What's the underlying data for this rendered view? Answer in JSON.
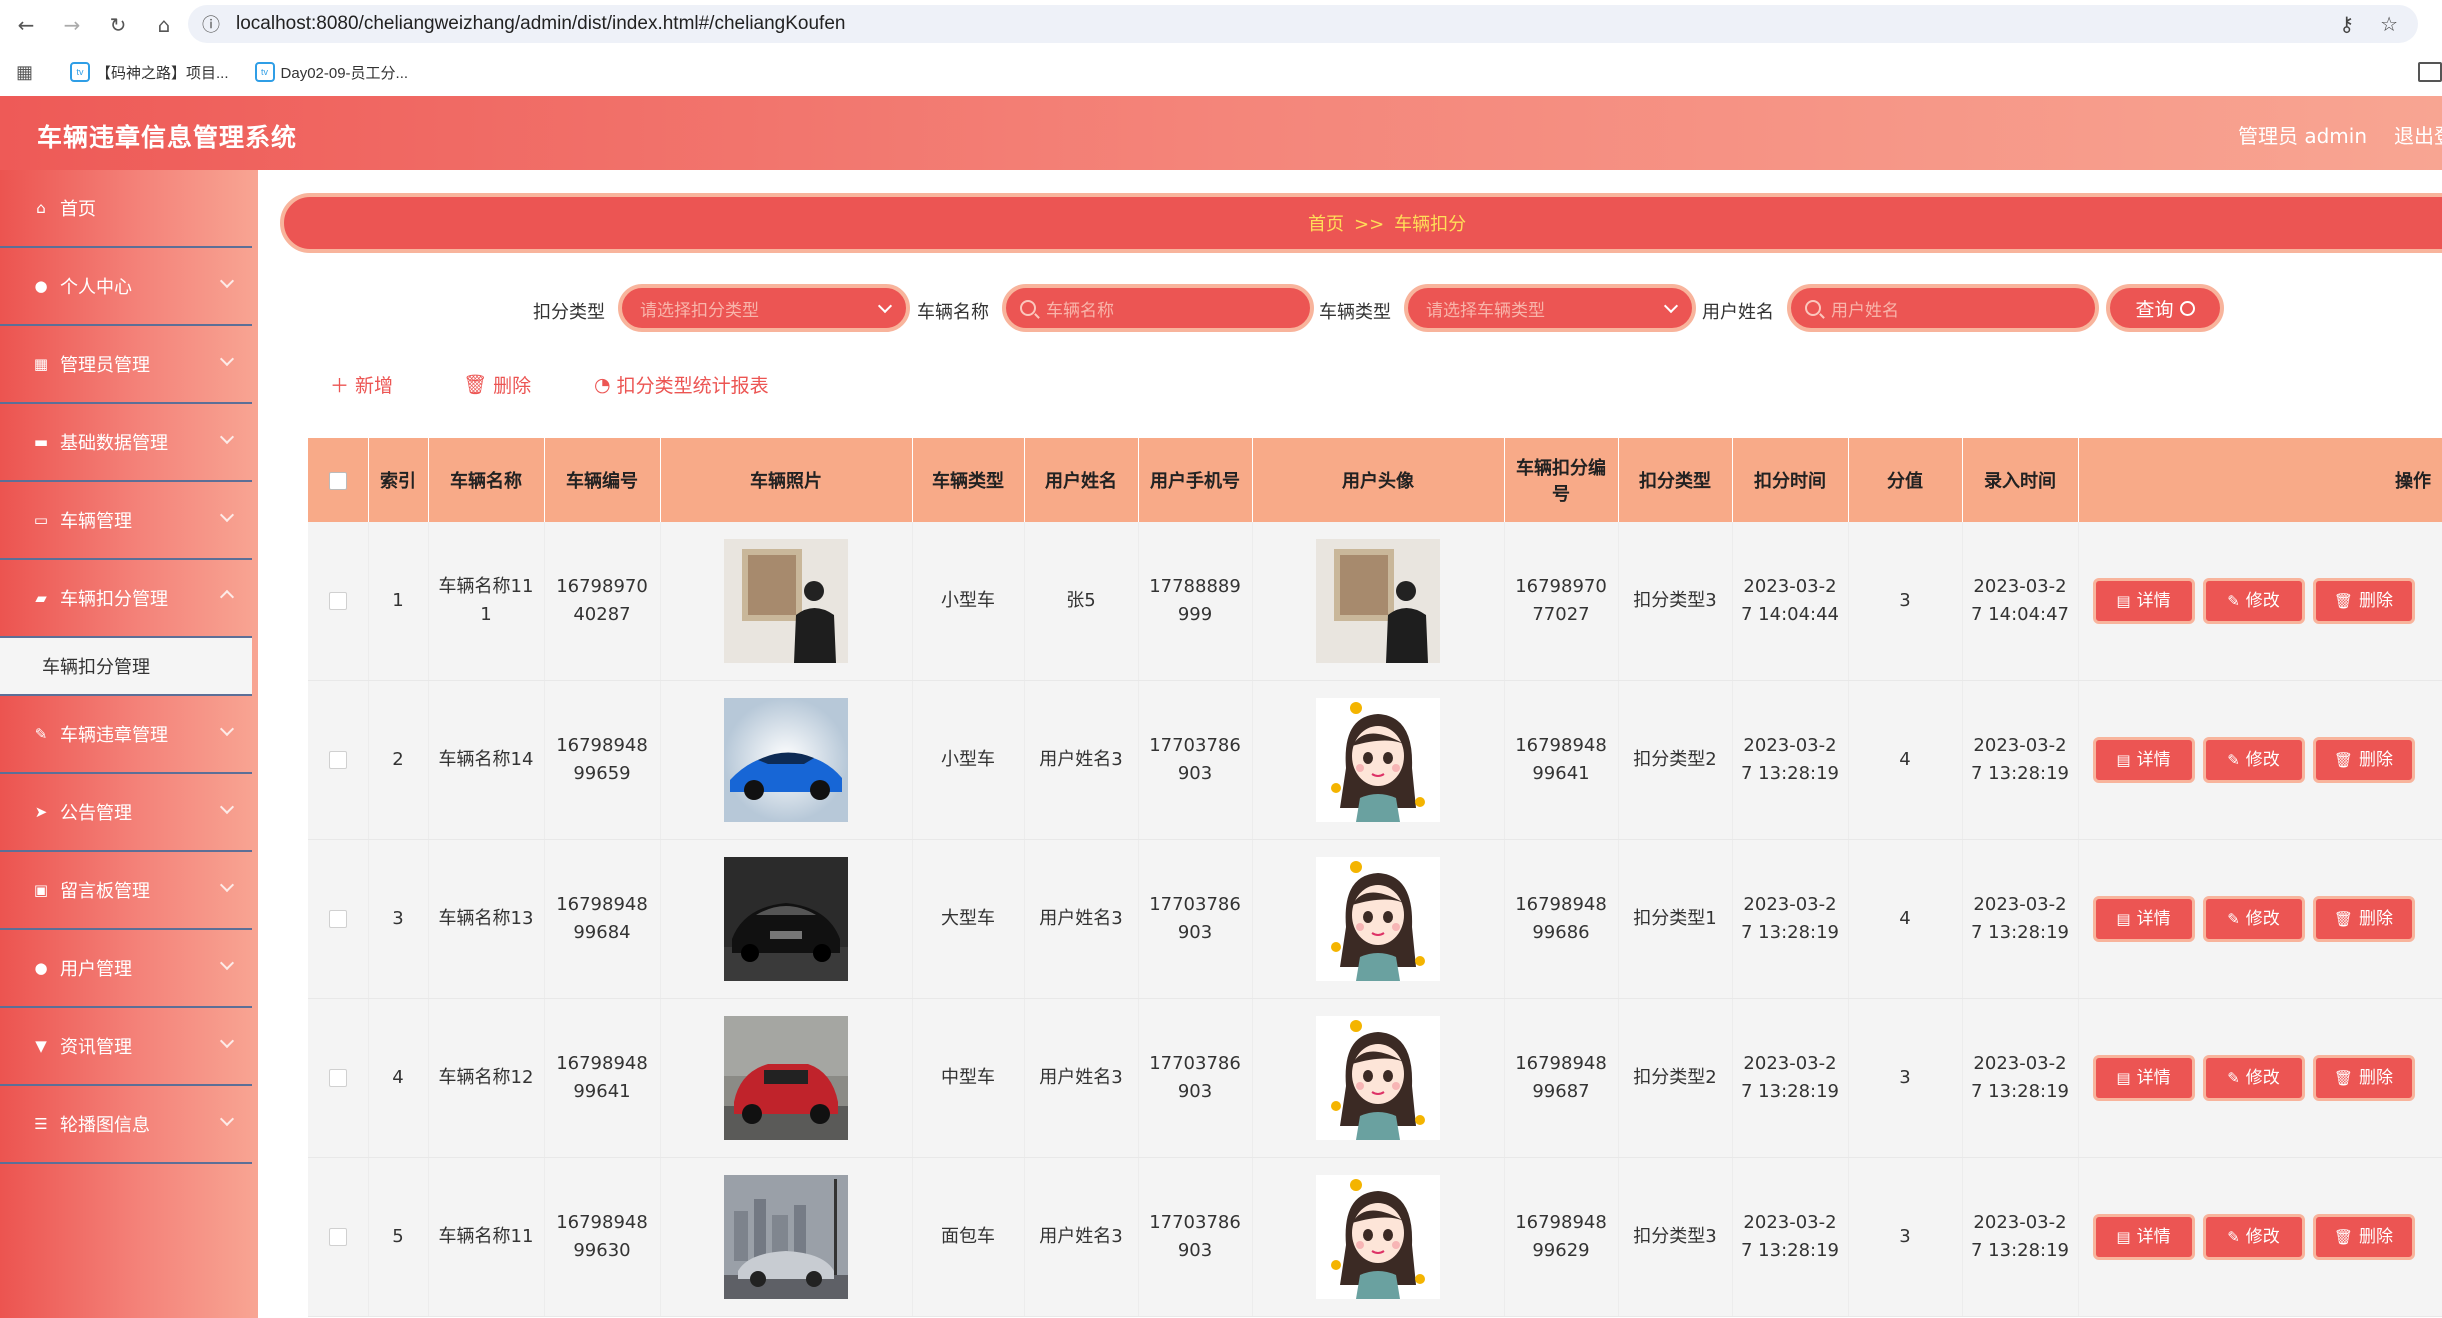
{
  "browser": {
    "url": "localhost:8080/cheliangweizhang/admin/dist/index.html#/cheliangKoufen",
    "bookmarks": [
      "【码神之路】项目...",
      "Day02-09-员工分..."
    ]
  },
  "header": {
    "title": "车辆违章信息管理系统",
    "user": "管理员 admin",
    "logout": "退出登录"
  },
  "sidebar": {
    "items": [
      {
        "label": "首页",
        "icon": "home-icon"
      },
      {
        "label": "个人中心",
        "icon": "user-icon"
      },
      {
        "label": "管理员管理",
        "icon": "grid-icon"
      },
      {
        "label": "基础数据管理",
        "icon": "database-icon"
      },
      {
        "label": "车辆管理",
        "icon": "monitor-icon"
      },
      {
        "label": "车辆扣分管理",
        "icon": "chat-icon"
      },
      {
        "label": "车辆违章管理",
        "icon": "edit-icon"
      },
      {
        "label": "公告管理",
        "icon": "send-icon"
      },
      {
        "label": "留言板管理",
        "icon": "picture-icon"
      },
      {
        "label": "用户管理",
        "icon": "user-icon"
      },
      {
        "label": "资讯管理",
        "icon": "trophy-icon"
      },
      {
        "label": "轮播图信息",
        "icon": "sliders-icon"
      }
    ],
    "active_sub": "车辆扣分管理"
  },
  "breadcrumb": {
    "home": "首页",
    "sep": ">>",
    "current": "车辆扣分"
  },
  "filters": {
    "koufen_type_label": "扣分类型",
    "koufen_type_placeholder": "请选择扣分类型",
    "car_name_label": "车辆名称",
    "car_name_placeholder": "车辆名称",
    "car_type_label": "车辆类型",
    "car_type_placeholder": "请选择车辆类型",
    "user_name_label": "用户姓名",
    "user_name_placeholder": "用户姓名",
    "query": "查询"
  },
  "actions": {
    "add": "新增",
    "delete": "删除",
    "report": "扣分类型统计报表"
  },
  "table": {
    "headers": [
      "索引",
      "车辆名称",
      "车辆编号",
      "车辆照片",
      "车辆类型",
      "用户姓名",
      "用户手机号",
      "用户头像",
      "车辆扣分编号",
      "扣分类型",
      "扣分时间",
      "分值",
      "录入时间",
      "操作"
    ],
    "buttons": {
      "detail": "详情",
      "edit": "修改",
      "delete": "删除"
    },
    "rows": [
      {
        "index": "1",
        "name": "车辆名称111",
        "code": "1679897040287",
        "type": "小型车",
        "user": "张5",
        "phone": "17788889999",
        "koufen_code": "1679897077027",
        "koufen_type": "扣分类型3",
        "time": "2023-03-27 14:04:44",
        "score": "3",
        "insert_time": "2023-03-27 14:04:47"
      },
      {
        "index": "2",
        "name": "车辆名称14",
        "code": "1679894899659",
        "type": "小型车",
        "user": "用户姓名3",
        "phone": "17703786903",
        "koufen_code": "1679894899641",
        "koufen_type": "扣分类型2",
        "time": "2023-03-27 13:28:19",
        "score": "4",
        "insert_time": "2023-03-27 13:28:19"
      },
      {
        "index": "3",
        "name": "车辆名称13",
        "code": "1679894899684",
        "type": "大型车",
        "user": "用户姓名3",
        "phone": "17703786903",
        "koufen_code": "1679894899686",
        "koufen_type": "扣分类型1",
        "time": "2023-03-27 13:28:19",
        "score": "4",
        "insert_time": "2023-03-27 13:28:19"
      },
      {
        "index": "4",
        "name": "车辆名称12",
        "code": "1679894899641",
        "type": "中型车",
        "user": "用户姓名3",
        "phone": "17703786903",
        "koufen_code": "1679894899687",
        "koufen_type": "扣分类型2",
        "time": "2023-03-27 13:28:19",
        "score": "3",
        "insert_time": "2023-03-27 13:28:19"
      },
      {
        "index": "5",
        "name": "车辆名称11",
        "code": "1679894899630",
        "type": "面包车",
        "user": "用户姓名3",
        "phone": "17703786903",
        "koufen_code": "1679894899629",
        "koufen_type": "扣分类型3",
        "time": "2023-03-27 13:28:19",
        "score": "3",
        "insert_time": "2023-03-27 13:28:19"
      }
    ]
  }
}
